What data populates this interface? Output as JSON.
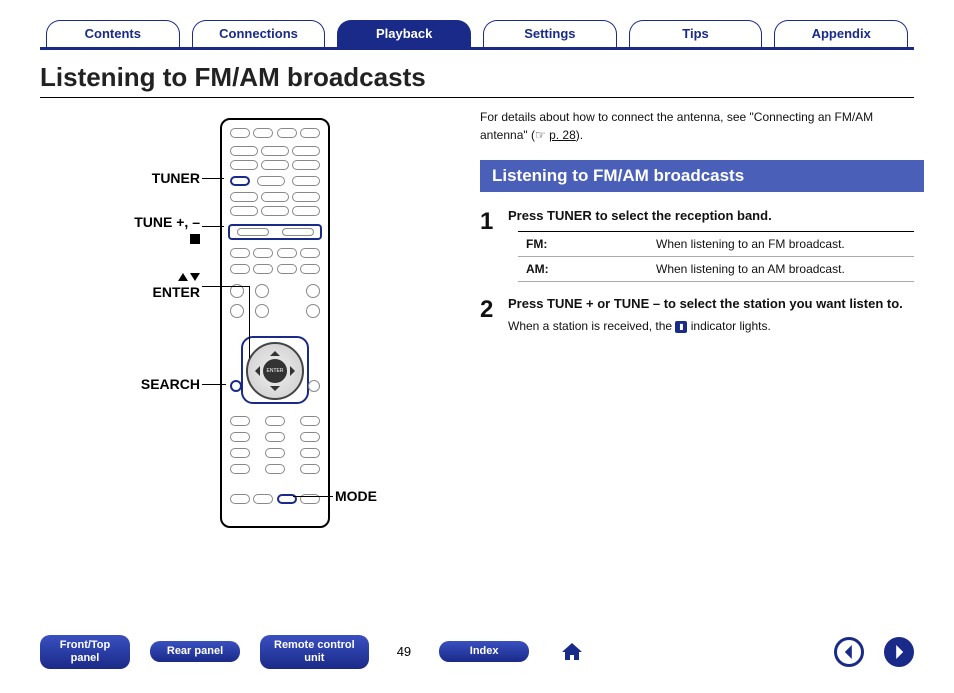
{
  "tabs": [
    "Contents",
    "Connections",
    "Playback",
    "Settings",
    "Tips",
    "Appendix"
  ],
  "active_tab_index": 2,
  "page_title": "Listening to FM/AM broadcasts",
  "callouts": {
    "tuner": "TUNER",
    "tune": "TUNE +, –",
    "enter": "ENTER",
    "search": "SEARCH",
    "mode": "MODE"
  },
  "intro": {
    "text_1": "For details about how to connect the antenna, see \"Connecting an FM/AM antenna\" (",
    "link_icon": "☞",
    "link": "p. 28",
    "text_2": ")."
  },
  "section_heading": "Listening to FM/AM broadcasts",
  "steps": [
    {
      "num": "1",
      "title": "Press TUNER to select the reception band.",
      "table": [
        {
          "key": "FM:",
          "val": "When listening to an FM broadcast."
        },
        {
          "key": "AM:",
          "val": "When listening to an AM broadcast."
        }
      ]
    },
    {
      "num": "2",
      "title": "Press TUNE + or TUNE – to select the station you want listen to.",
      "note_pre": "When a station is received, the ",
      "note_post": " indicator lights."
    }
  ],
  "bottom": {
    "buttons": [
      "Front/Top\npanel",
      "Rear panel",
      "Remote control\nunit"
    ],
    "page": "49",
    "index": "Index"
  }
}
